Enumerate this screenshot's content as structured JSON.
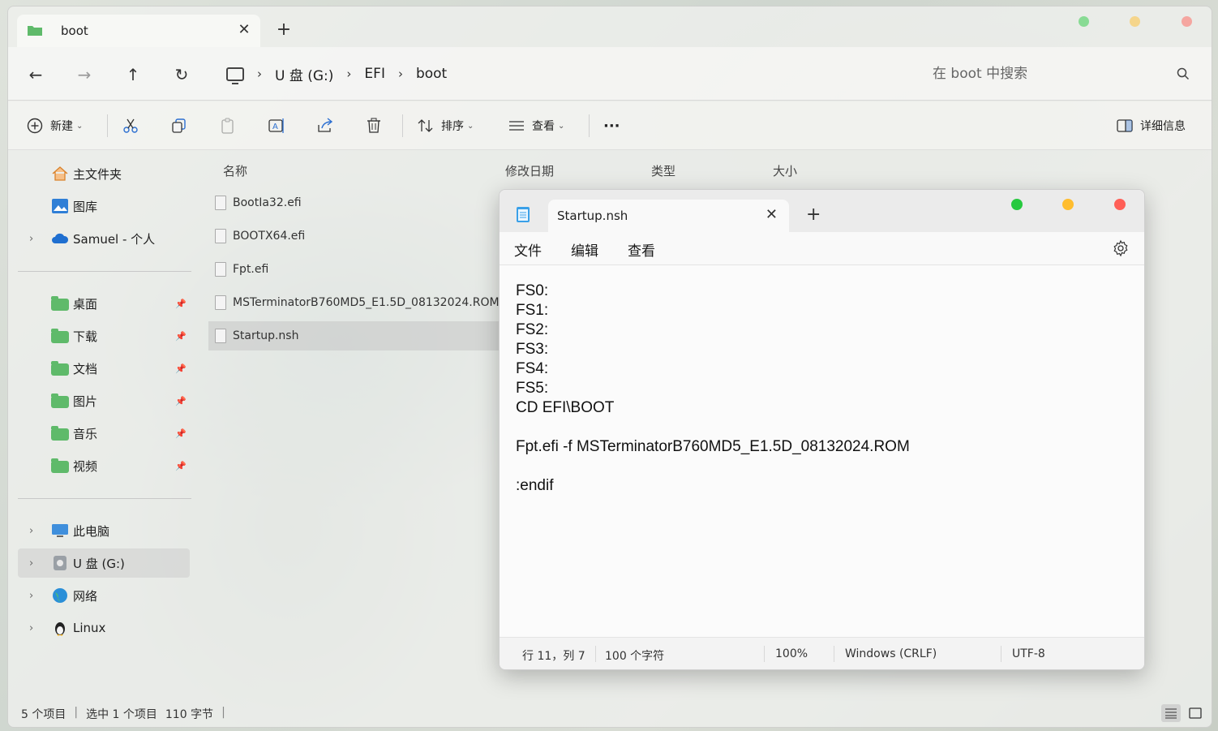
{
  "explorer": {
    "tab_title": "boot",
    "tab_close": "✕",
    "new_tab": "+",
    "breadcrumb": [
      "U 盘 (G:)",
      "EFI",
      "boot"
    ],
    "search_placeholder": "在 boot 中搜索",
    "toolbar": {
      "new_label": "新建",
      "sort_label": "排序",
      "view_label": "查看",
      "more_label": "···",
      "details_label": "详细信息"
    },
    "sidebar": {
      "home": "主文件夹",
      "gallery": "图库",
      "onedrive": "Samuel - 个人",
      "desktop": "桌面",
      "downloads": "下载",
      "documents": "文档",
      "pictures": "图片",
      "music": "音乐",
      "videos": "视频",
      "this_pc": "此电脑",
      "usb": "U 盘 (G:)",
      "network": "网络",
      "linux": "Linux"
    },
    "columns": {
      "name": "名称",
      "modified": "修改日期",
      "type": "类型",
      "size": "大小"
    },
    "files": [
      "BootIa32.efi",
      "BOOTX64.efi",
      "Fpt.efi",
      "MSTerminatorB760MD5_E1.5D_08132024.ROM",
      "Startup.nsh"
    ],
    "status": {
      "items": "5 个项目",
      "selected": "选中 1 个项目",
      "size": "110 字节"
    }
  },
  "notepad": {
    "tab_title": "Startup.nsh",
    "tab_close": "✕",
    "new_tab": "+",
    "menu": {
      "file": "文件",
      "edit": "编辑",
      "view": "查看"
    },
    "content": "FS0:\nFS1:\nFS2:\nFS3:\nFS4:\nFS5:\nCD EFI\\BOOT\n\nFpt.efi -f MSTerminatorB760MD5_E1.5D_08132024.ROM\n\n:endif",
    "status": {
      "position": "行 11，列 7",
      "chars": "100 个字符",
      "zoom": "100%",
      "eol": "Windows (CRLF)",
      "encoding": "UTF-8"
    },
    "colors": {
      "green": "#27c93f",
      "yellow": "#ffbd2e",
      "red": "#ff5f57"
    }
  }
}
